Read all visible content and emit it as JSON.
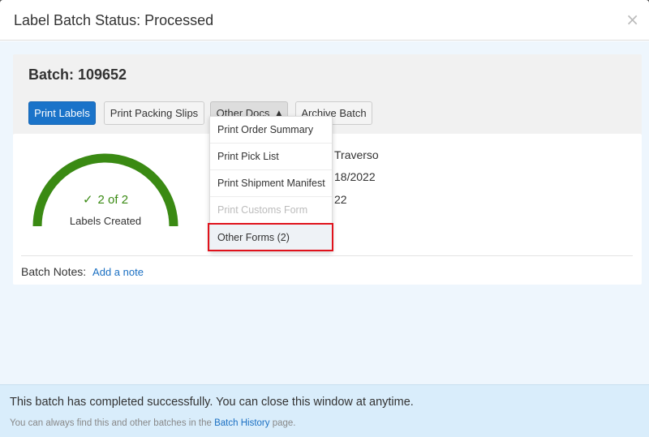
{
  "modal": {
    "title": "Label Batch Status: Processed",
    "close_glyph": "×"
  },
  "batch": {
    "title": "Batch: 109652",
    "buttons": {
      "print_labels": "Print Labels",
      "print_packing_slips": "Print Packing Slips",
      "other_docs": "Other Docs",
      "archive_batch": "Archive Batch"
    }
  },
  "gauge": {
    "count_text": "2 of 2",
    "caption": "Labels Created",
    "progress": 1.0,
    "color": "#3a8a13"
  },
  "info": {
    "line1": "Traverso",
    "line2": "18/2022",
    "line3": "22"
  },
  "notes": {
    "label": "Batch Notes:",
    "add_link": "Add a note"
  },
  "dropdown": {
    "items": [
      {
        "label": "Print Order Summary",
        "disabled": false
      },
      {
        "label": "Print Pick List",
        "disabled": false
      },
      {
        "label": "Print Shipment Manifest",
        "disabled": false
      },
      {
        "label": "Print Customs Form",
        "disabled": true
      },
      {
        "label": "Other Forms (2)",
        "disabled": false
      }
    ]
  },
  "footer": {
    "main": "This batch has completed successfully. You can close this window at anytime.",
    "sub_prefix": "You can always find this and other batches in the ",
    "sub_link": "Batch History",
    "sub_suffix": " page."
  },
  "colors": {
    "primary": "#1a73c9",
    "success": "#3a8a13",
    "highlight": "#e0121b",
    "footer_bg": "#d9edfb"
  }
}
